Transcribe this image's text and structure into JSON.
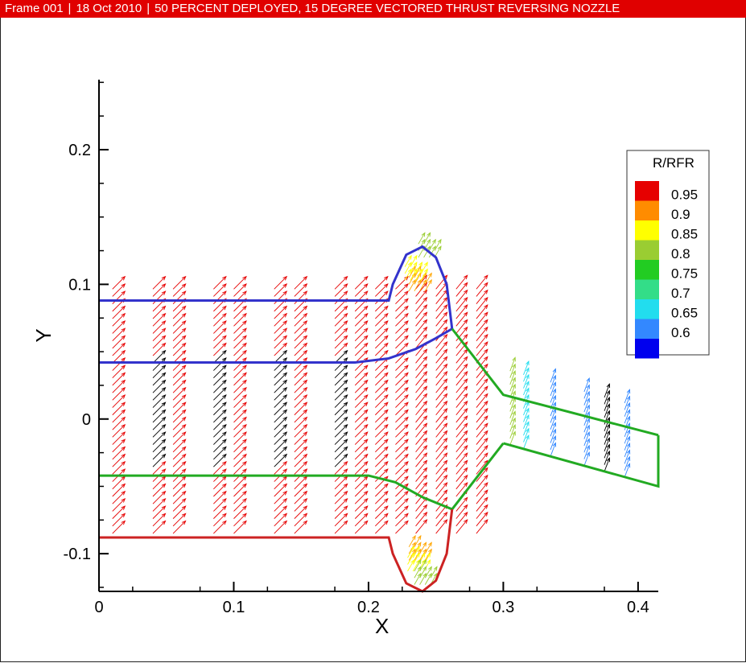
{
  "header": {
    "frame": "Frame 001",
    "date": "18 Oct 2010",
    "title": "50 PERCENT DEPLOYED, 15 DEGREE VECTORED THRUST REVERSING NOZZLE"
  },
  "chart_data": {
    "type": "vector-field",
    "title": "50 PERCENT DEPLOYED, 15 DEGREE VECTORED THRUST REVERSING NOZZLE",
    "xlabel": "X",
    "ylabel": "Y",
    "xlim": [
      0,
      0.415
    ],
    "ylim": [
      -0.128,
      0.252
    ],
    "xticks": [
      "0",
      "0.1",
      "0.2",
      "0.3",
      "0.4"
    ],
    "yticks": [
      "-0.1",
      "0",
      "0.1",
      "0.2"
    ],
    "xtick_values": [
      0,
      0.1,
      0.2,
      0.3,
      0.4
    ],
    "ytick_values": [
      -0.1,
      0,
      0.1,
      0.2
    ],
    "grid": false,
    "legend": {
      "title": "R/RFR",
      "placement": "right",
      "levels": [
        {
          "label": "0.95",
          "color": "#e60000"
        },
        {
          "label": "0.9",
          "color": "#ff8c00"
        },
        {
          "label": "0.85",
          "color": "#ffff00"
        },
        {
          "label": "0.8",
          "color": "#9acd32"
        },
        {
          "label": "0.75",
          "color": "#22cc22"
        },
        {
          "label": "0.7",
          "color": "#33dd88"
        },
        {
          "label": "0.65",
          "color": "#22ddee"
        },
        {
          "label": "0.6",
          "color": "#3388ff"
        },
        {
          "label": "",
          "color": "#0000ee"
        }
      ]
    },
    "boundaries": [
      {
        "color": "#3333cc",
        "points": [
          [
            0,
            0.088
          ],
          [
            0.215,
            0.088
          ],
          [
            0.218,
            0.1
          ],
          [
            0.228,
            0.122
          ],
          [
            0.24,
            0.128
          ],
          [
            0.25,
            0.12
          ],
          [
            0.258,
            0.1
          ],
          [
            0.262,
            0.067
          ]
        ]
      },
      {
        "color": "#3333cc",
        "points": [
          [
            0,
            0.042
          ],
          [
            0.19,
            0.042
          ],
          [
            0.215,
            0.045
          ],
          [
            0.235,
            0.052
          ],
          [
            0.25,
            0.06
          ],
          [
            0.262,
            0.067
          ]
        ]
      },
      {
        "color": "#22aa22",
        "points": [
          [
            0.262,
            0.067
          ],
          [
            0.3,
            0.018
          ],
          [
            0.415,
            -0.012
          ]
        ]
      },
      {
        "color": "#22aa22",
        "points": [
          [
            0.3,
            -0.018
          ],
          [
            0.415,
            -0.05
          ],
          [
            0.415,
            -0.012
          ]
        ]
      },
      {
        "color": "#22aa22",
        "points": [
          [
            0,
            -0.042
          ],
          [
            0.2,
            -0.042
          ],
          [
            0.22,
            -0.047
          ],
          [
            0.24,
            -0.058
          ],
          [
            0.262,
            -0.067
          ],
          [
            0.3,
            -0.018
          ]
        ]
      },
      {
        "color": "#cc2222",
        "points": [
          [
            0,
            -0.088
          ],
          [
            0.215,
            -0.088
          ],
          [
            0.218,
            -0.1
          ],
          [
            0.228,
            -0.122
          ],
          [
            0.24,
            -0.128
          ],
          [
            0.25,
            -0.12
          ],
          [
            0.258,
            -0.1
          ],
          [
            0.262,
            -0.067
          ]
        ]
      }
    ]
  }
}
